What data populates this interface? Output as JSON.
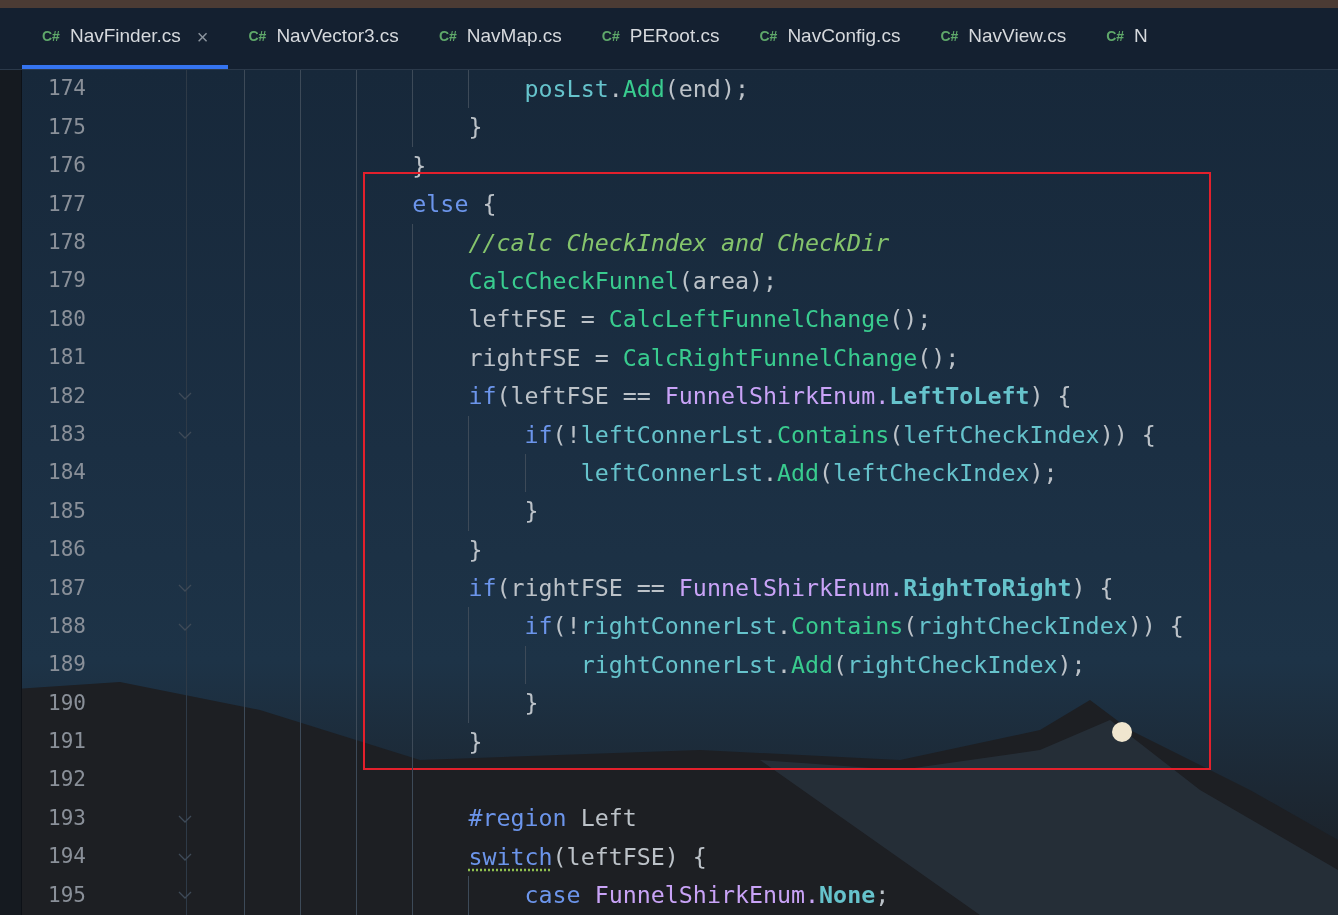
{
  "tabs": [
    {
      "icon": "C#",
      "label": "NavFinder.cs",
      "selected": true,
      "close": "×"
    },
    {
      "icon": "C#",
      "label": "NavVector3.cs",
      "selected": false
    },
    {
      "icon": "C#",
      "label": "NavMap.cs",
      "selected": false
    },
    {
      "icon": "C#",
      "label": "PERoot.cs",
      "selected": false
    },
    {
      "icon": "C#",
      "label": "NavConfig.cs",
      "selected": false
    },
    {
      "icon": "C#",
      "label": "NavView.cs",
      "selected": false
    },
    {
      "icon": "C#",
      "label": "N",
      "selected": false
    }
  ],
  "blocks": [
    {
      "highlighted": false,
      "lines": [
        {
          "number": "174",
          "foldable": false,
          "tokens": [
            {
              "kind": "field",
              "text": "                    posLst"
            },
            {
              "kind": "plain",
              "text": "."
            },
            {
              "kind": "method",
              "text": "Add"
            },
            {
              "kind": "plain",
              "text": "(end);"
            }
          ]
        },
        {
          "number": "175",
          "foldable": false,
          "tokens": [
            {
              "kind": "plain",
              "text": "                }"
            }
          ]
        },
        {
          "number": "176",
          "foldable": false,
          "tokens": [
            {
              "kind": "plain",
              "text": "            }"
            }
          ]
        }
      ]
    },
    {
      "highlighted": true,
      "lines": [
        {
          "number": "177",
          "foldable": false,
          "tokens": [
            {
              "kind": "keyword",
              "text": "            else"
            },
            {
              "kind": "plain",
              "text": " {"
            }
          ]
        },
        {
          "number": "178",
          "foldable": false,
          "tokens": [
            {
              "kind": "comment",
              "text": "                //calc CheckIndex and CheckDir"
            }
          ]
        },
        {
          "number": "179",
          "foldable": false,
          "tokens": [
            {
              "kind": "method",
              "text": "                CalcCheckFunnel"
            },
            {
              "kind": "plain",
              "text": "(area);"
            }
          ]
        },
        {
          "number": "180",
          "foldable": false,
          "tokens": [
            {
              "kind": "plain",
              "text": "                leftFSE = "
            },
            {
              "kind": "method",
              "text": "CalcLeftFunnelChange"
            },
            {
              "kind": "plain",
              "text": "();"
            }
          ]
        },
        {
          "number": "181",
          "foldable": false,
          "tokens": [
            {
              "kind": "plain",
              "text": "                rightFSE = "
            },
            {
              "kind": "method",
              "text": "CalcRightFunnelChange"
            },
            {
              "kind": "plain",
              "text": "();"
            }
          ]
        },
        {
          "number": "182",
          "foldable": true,
          "tokens": [
            {
              "kind": "keyword",
              "text": "                if"
            },
            {
              "kind": "plain",
              "text": "(leftFSE == "
            },
            {
              "kind": "type",
              "text": "FunnelShirkEnum."
            },
            {
              "kind": "member",
              "text": "LeftToLeft"
            },
            {
              "kind": "plain",
              "text": ") {"
            }
          ]
        },
        {
          "number": "183",
          "foldable": true,
          "tokens": [
            {
              "kind": "keyword",
              "text": "                    if"
            },
            {
              "kind": "plain",
              "text": "(!"
            },
            {
              "kind": "field",
              "text": "leftConnerLst"
            },
            {
              "kind": "plain",
              "text": "."
            },
            {
              "kind": "method",
              "text": "Contains"
            },
            {
              "kind": "plain",
              "text": "("
            },
            {
              "kind": "field",
              "text": "leftCheckIndex"
            },
            {
              "kind": "plain",
              "text": ")) {"
            }
          ]
        },
        {
          "number": "184",
          "foldable": false,
          "tokens": [
            {
              "kind": "field",
              "text": "                        leftConnerLst"
            },
            {
              "kind": "plain",
              "text": "."
            },
            {
              "kind": "method",
              "text": "Add"
            },
            {
              "kind": "plain",
              "text": "("
            },
            {
              "kind": "field",
              "text": "leftCheckIndex"
            },
            {
              "kind": "plain",
              "text": ");"
            }
          ]
        },
        {
          "number": "185",
          "foldable": false,
          "tokens": [
            {
              "kind": "plain",
              "text": "                    }"
            }
          ]
        },
        {
          "number": "186",
          "foldable": false,
          "tokens": [
            {
              "kind": "plain",
              "text": "                }"
            }
          ]
        },
        {
          "number": "187",
          "foldable": true,
          "tokens": [
            {
              "kind": "keyword",
              "text": "                if"
            },
            {
              "kind": "plain",
              "text": "(rightFSE == "
            },
            {
              "kind": "type",
              "text": "FunnelShirkEnum."
            },
            {
              "kind": "member",
              "text": "RightToRight"
            },
            {
              "kind": "plain",
              "text": ") {"
            }
          ]
        },
        {
          "number": "188",
          "foldable": true,
          "tokens": [
            {
              "kind": "keyword",
              "text": "                    if"
            },
            {
              "kind": "plain",
              "text": "(!"
            },
            {
              "kind": "field",
              "text": "rightConnerLst"
            },
            {
              "kind": "plain",
              "text": "."
            },
            {
              "kind": "method",
              "text": "Contains"
            },
            {
              "kind": "plain",
              "text": "("
            },
            {
              "kind": "field",
              "text": "rightCheckIndex"
            },
            {
              "kind": "plain",
              "text": ")) {"
            }
          ]
        },
        {
          "number": "189",
          "foldable": false,
          "tokens": [
            {
              "kind": "field",
              "text": "                        rightConnerLst"
            },
            {
              "kind": "plain",
              "text": "."
            },
            {
              "kind": "method",
              "text": "Add"
            },
            {
              "kind": "plain",
              "text": "("
            },
            {
              "kind": "field",
              "text": "rightCheckIndex"
            },
            {
              "kind": "plain",
              "text": ");"
            }
          ]
        },
        {
          "number": "190",
          "foldable": false,
          "tokens": [
            {
              "kind": "plain",
              "text": "                    }"
            }
          ]
        },
        {
          "number": "191",
          "foldable": false,
          "tokens": [
            {
              "kind": "plain",
              "text": "                }"
            }
          ]
        }
      ]
    },
    {
      "highlighted": false,
      "lines": [
        {
          "number": "192",
          "foldable": false
        },
        {
          "number": "193",
          "foldable": true,
          "tokens": [
            {
              "kind": "keyword",
              "text": "                #region"
            },
            {
              "kind": "plain",
              "text": " Left"
            }
          ]
        },
        {
          "number": "194",
          "foldable": true,
          "tokens": [
            {
              "kind": "keyword",
              "text": "                switch",
              "squiggle": true
            },
            {
              "kind": "plain",
              "text": "(leftFSE) {"
            }
          ]
        },
        {
          "number": "195",
          "foldable": true,
          "tokens": [
            {
              "kind": "keyword",
              "text": "                    case"
            },
            {
              "kind": "type",
              "text": " FunnelShirkEnum."
            },
            {
              "kind": "member",
              "text": "None"
            },
            {
              "kind": "plain",
              "text": ";"
            }
          ]
        }
      ]
    }
  ]
}
